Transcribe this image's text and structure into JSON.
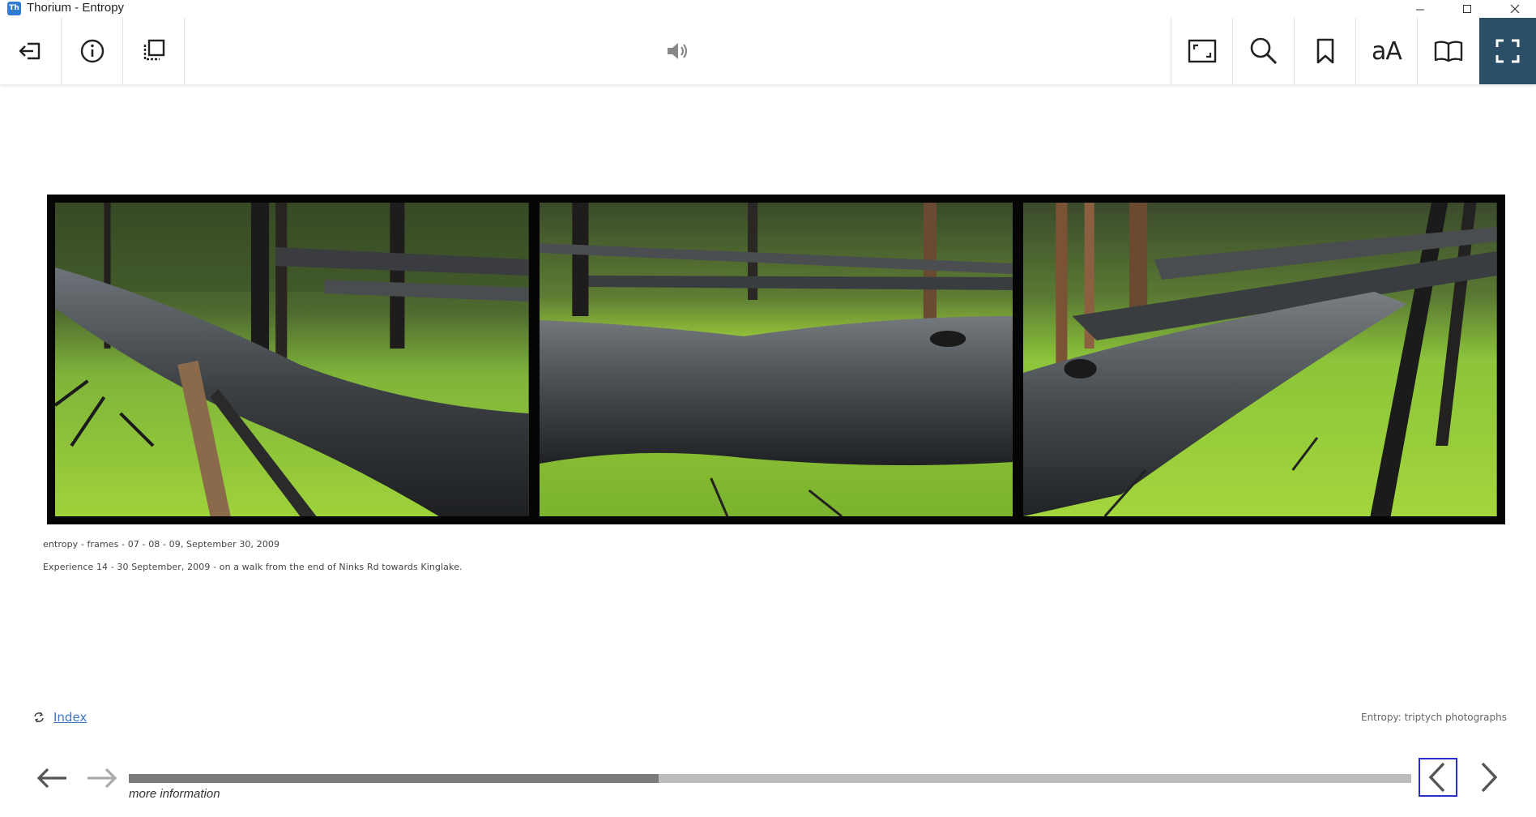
{
  "window": {
    "app_icon_text": "Th",
    "title": "Thorium - Entropy"
  },
  "toolbar": {
    "left": [
      "back-to-library-icon",
      "info-icon",
      "toc-icon"
    ],
    "center": [
      "audio-icon"
    ],
    "right": [
      "fit-screen-icon",
      "search-icon",
      "bookmark-icon",
      "text-settings-icon",
      "reading-mode-icon",
      "fullscreen-icon"
    ],
    "text_settings_label": "aA",
    "active_color": "#2b4f66"
  },
  "content": {
    "caption_title": "entropy - frames - 07 - 08 - 09, September 30, 2009",
    "caption_text": "Experience 14 - 30 September, 2009 - on a walk from the end of Ninks Rd towards Kinglake.",
    "index_link": "Index",
    "book_subtitle": "Entropy: triptych photographs"
  },
  "navigation": {
    "progress": 0.413,
    "progress_label": "more information"
  }
}
